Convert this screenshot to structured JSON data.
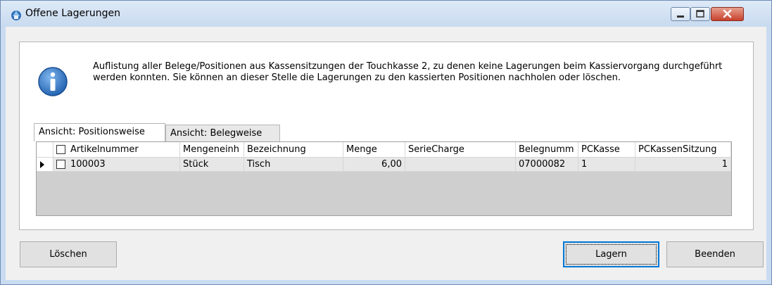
{
  "window": {
    "title": "Offene Lagerungen",
    "controls": {
      "minimize": "–",
      "maximize": "□",
      "close": "✕"
    }
  },
  "description": "Auflistung aller Belege/Positionen aus Kassensitzungen der Touchkasse 2, zu denen keine Lagerungen beim Kassiervorgang durchgeführt werden konnten. Sie können an dieser Stelle die Lagerungen zu den kassierten Positionen nachholen oder löschen.",
  "tabs": [
    {
      "label": "Ansicht: Positionsweise",
      "active": true
    },
    {
      "label": "Ansicht: Belegweise",
      "active": false
    }
  ],
  "grid": {
    "columns": [
      "Artikelnummer",
      "Mengeneinh",
      "Bezeichnung",
      "Menge",
      "SerieCharge",
      "Belegnumm",
      "PCKasse",
      "PCKassenSitzung"
    ],
    "rows": [
      {
        "checked": false,
        "cells": [
          "100003",
          "Stück",
          "Tisch",
          "6,00",
          "",
          "07000082",
          "1",
          "1"
        ]
      }
    ]
  },
  "buttons": {
    "delete": "Löschen",
    "store": "Lagern",
    "close": "Beenden"
  },
  "colors": {
    "info_blue": "#2a72c8",
    "close_red": "#c7412c",
    "focus_blue": "#0078d7"
  }
}
